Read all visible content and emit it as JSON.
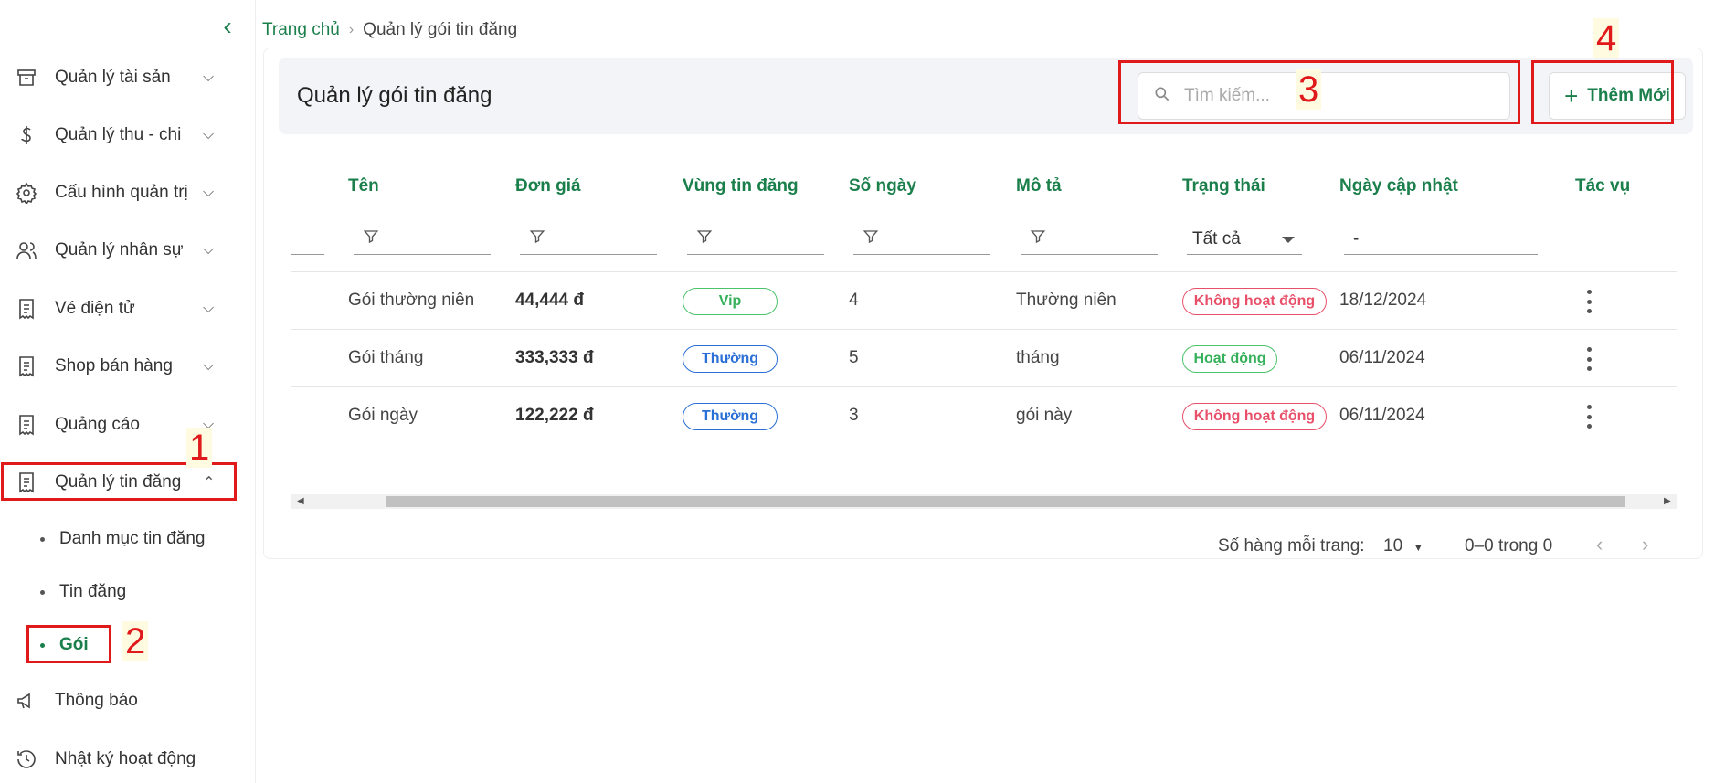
{
  "sidebar": {
    "items": [
      {
        "label": "Quản lý tài sản",
        "icon": "archive-icon"
      },
      {
        "label": "Quản lý thu - chi",
        "icon": "dollar-icon"
      },
      {
        "label": "Cấu hình quản trị",
        "icon": "gear-icon"
      },
      {
        "label": "Quản lý nhân sự",
        "icon": "users-icon"
      },
      {
        "label": "Vé điện tử",
        "icon": "receipt-icon"
      },
      {
        "label": "Shop bán hàng",
        "icon": "receipt-icon"
      },
      {
        "label": "Quảng cáo",
        "icon": "receipt-icon"
      },
      {
        "label": "Quản lý tin đăng",
        "icon": "receipt-icon"
      }
    ],
    "sub_items": [
      {
        "label": "Danh mục tin đăng"
      },
      {
        "label": "Tin đăng"
      },
      {
        "label": "Gói"
      }
    ],
    "bottom_items": [
      {
        "label": "Thông báo",
        "icon": "megaphone-icon"
      },
      {
        "label": "Nhật ký hoạt động",
        "icon": "history-icon"
      }
    ]
  },
  "markers": [
    "1",
    "2",
    "3",
    "4"
  ],
  "breadcrumb": {
    "home": "Trang chủ",
    "current": "Quản lý gói tin đăng"
  },
  "page": {
    "title": "Quản lý gói tin đăng",
    "search_placeholder": "Tìm kiếm...",
    "add_label": "Thêm Mới"
  },
  "table": {
    "columns": [
      "Tên",
      "Đơn giá",
      "Vùng tin đăng",
      "Số ngày",
      "Mô tả",
      "Trạng thái",
      "Ngày cập nhật",
      "Tác vụ"
    ],
    "status_filter": "Tất cả",
    "date_filter": "-",
    "rows": [
      {
        "name": "Gói thường niên",
        "price": "44,444 đ",
        "region": "Vip",
        "days": "4",
        "desc": "Thường niên",
        "status": "Không hoạt động",
        "updated": "18/12/2024"
      },
      {
        "name": "Gói tháng",
        "price": "333,333 đ",
        "region": "Thường",
        "days": "5",
        "desc": "tháng",
        "status": "Hoạt động",
        "updated": "06/11/2024"
      },
      {
        "name": "Gói ngày",
        "price": "122,222 đ",
        "region": "Thường",
        "days": "3",
        "desc": "gói này",
        "status": "Không hoạt động",
        "updated": "06/11/2024"
      }
    ]
  },
  "pagination": {
    "rows_label": "Số hàng mỗi trang:",
    "rows_value": "10",
    "range": "0–0 trong 0"
  },
  "colors": {
    "accent": "#1a7f4b",
    "danger": "#e8506a",
    "info": "#2a6fd6",
    "annotation": "#e0191b"
  }
}
